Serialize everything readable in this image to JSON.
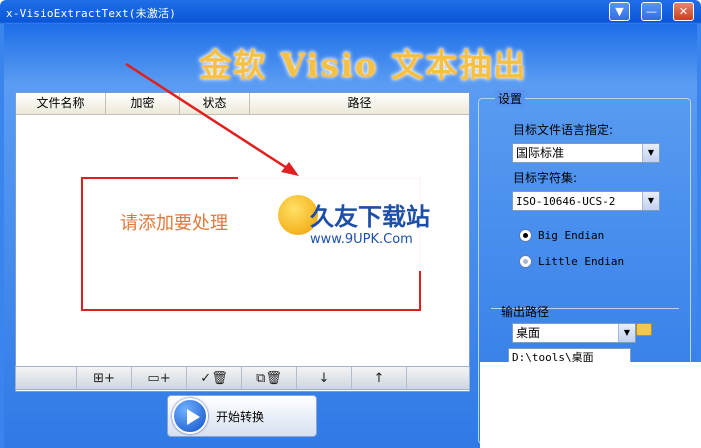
{
  "window": {
    "title": "x-VisioExtractText(未激活)"
  },
  "title_buttons": [
    "▼",
    "—",
    "✕"
  ],
  "banner": "金软 Visio 文本抽出",
  "file_list": {
    "columns": [
      "文件名称",
      "加密",
      "状态",
      "路径"
    ],
    "hint": "请添加要处理"
  },
  "toolbar": {
    "icons": [
      "add-file-icon",
      "add-folder-icon",
      "remove-checked-icon",
      "remove-all-icon",
      "move-down-icon",
      "move-up-icon"
    ],
    "glyphs": [
      "⊞+",
      "▭+",
      "✓🗑",
      "⧉🗑",
      "↓",
      "↑"
    ]
  },
  "start_button": {
    "label": "开始转换"
  },
  "settings": {
    "legend": "设置",
    "language_label": "目标文件语言指定:",
    "language_value": "国际标准",
    "charset_label": "目标字符集:",
    "charset_value": "ISO-10646-UCS-2",
    "big_endian": "Big Endian",
    "little_endian": "Little Endian",
    "output_label": "输出路径",
    "output_value": "桌面",
    "output_path": "D:\\tools\\桌面"
  },
  "watermark": {
    "title": "久友下载站",
    "url": "www.9UPK.Com"
  }
}
